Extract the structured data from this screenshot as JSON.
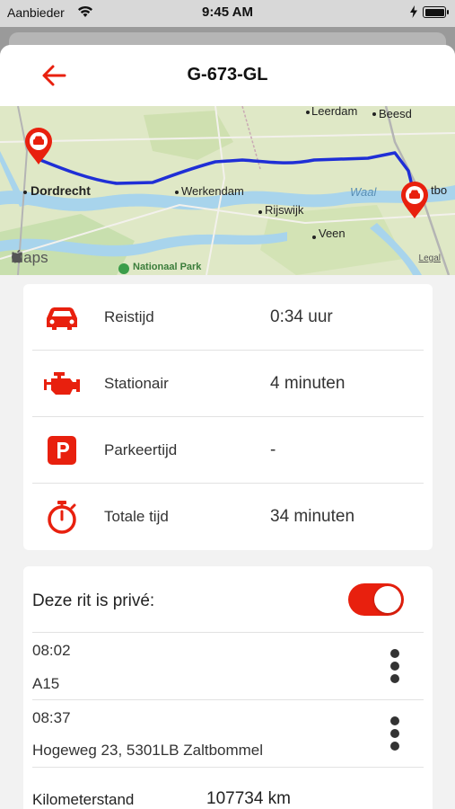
{
  "status_bar": {
    "carrier": "Aanbieder",
    "time": "9:45 AM"
  },
  "header": {
    "title": "G-673-GL",
    "back_icon": "arrow-left-icon"
  },
  "map": {
    "places": {
      "dordrecht": "Dordrecht",
      "werkendam": "Werkendam",
      "rijswijk": "Rijswijk",
      "veen": "Veen",
      "leerdam": "Leerdam",
      "beesd": "Beesd",
      "waal": "Waal",
      "zaltbommel_partial": "tbo",
      "park": "Nationaal Park"
    },
    "brand": "Maps",
    "legal": "Legal",
    "route_color": "#1f2fd6",
    "pin_color": "#e8200e"
  },
  "stats": [
    {
      "icon": "car-icon",
      "label": "Reistijd",
      "value": "0:34 uur"
    },
    {
      "icon": "engine-icon",
      "label": "Stationair",
      "value": "4 minuten"
    },
    {
      "icon": "parking-icon",
      "label": "Parkeertijd",
      "value": "-"
    },
    {
      "icon": "stopwatch-icon",
      "label": "Totale tijd",
      "value": "34 minuten"
    }
  ],
  "trip": {
    "private_label": "Deze rit is privé:",
    "private_on": true,
    "start": {
      "time": "08:02",
      "place": "A15"
    },
    "end": {
      "time": "08:37",
      "place": "Hogeweg 23, 5301LB Zaltbommel"
    },
    "odometer_label": "Kilometerstand",
    "odometer_value": "107734 km"
  },
  "colors": {
    "accent": "#e8200e",
    "background": "#f2f2f2"
  }
}
